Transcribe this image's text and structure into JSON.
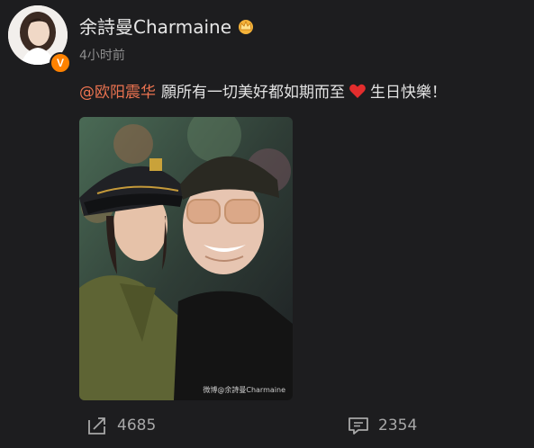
{
  "post": {
    "author": "余詩曼Charmaine",
    "verified_badge": "V",
    "time": "4小时前",
    "mention": "@欧阳震华",
    "text_before_heart": "願所有一切美好都如期而至",
    "text_after_heart": "生日快樂！",
    "watermark": "微博@余詩曼Charmaine"
  },
  "actions": {
    "repost_count": "4685",
    "comment_count": "2354"
  },
  "icons": {
    "crown": "crown-icon",
    "heart": "heart-icon",
    "repost": "share-icon",
    "comment": "comment-icon"
  },
  "colors": {
    "background": "#1d1d1f",
    "mention": "#eb7350",
    "badge": "#ff8200",
    "heart": "#e32d2d"
  }
}
